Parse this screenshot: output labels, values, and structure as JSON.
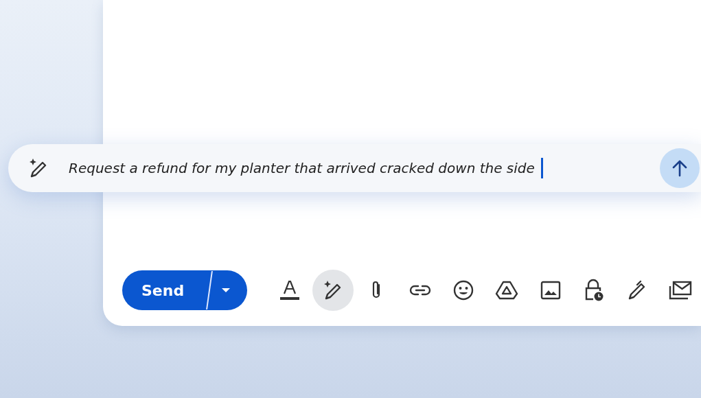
{
  "prompt": {
    "value": "Request a refund for my planter that arrived cracked down the side",
    "cursor": true
  },
  "send_button": {
    "label": "Send"
  },
  "toolbar": [
    {
      "kind": "format",
      "selected": false
    },
    {
      "kind": "write",
      "selected": true
    },
    {
      "kind": "attach",
      "selected": false
    },
    {
      "kind": "link",
      "selected": false
    },
    {
      "kind": "emoji",
      "selected": false
    },
    {
      "kind": "drive",
      "selected": false
    },
    {
      "kind": "photo",
      "selected": false
    },
    {
      "kind": "confidential",
      "selected": false
    },
    {
      "kind": "signature",
      "selected": false
    },
    {
      "kind": "template",
      "selected": false
    }
  ]
}
